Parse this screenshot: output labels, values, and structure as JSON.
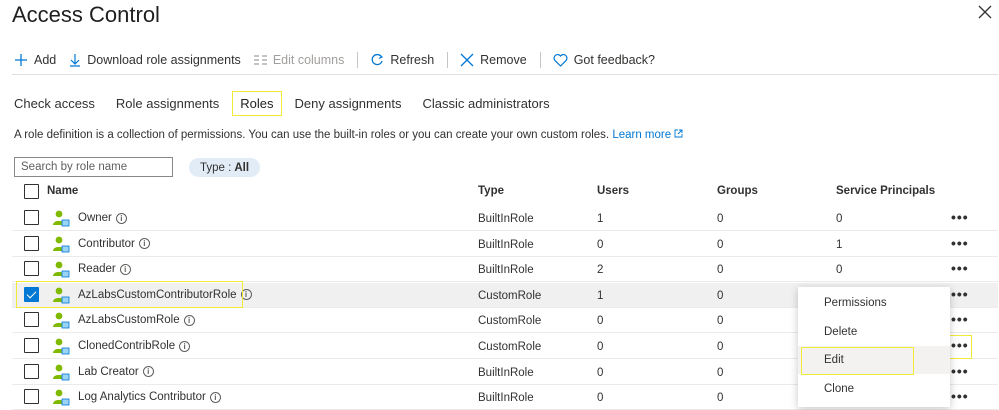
{
  "header": {
    "title": "Access Control"
  },
  "toolbar": {
    "add": "Add",
    "download": "Download role assignments",
    "edit_columns": "Edit columns",
    "refresh": "Refresh",
    "remove": "Remove",
    "feedback": "Got feedback?"
  },
  "tabs": [
    {
      "label": "Check access"
    },
    {
      "label": "Role assignments"
    },
    {
      "label": "Roles"
    },
    {
      "label": "Deny assignments"
    },
    {
      "label": "Classic administrators"
    }
  ],
  "description": {
    "text": "A role definition is a collection of permissions. You can use the built-in roles or you can create your own custom roles.",
    "link": "Learn more"
  },
  "filter": {
    "search_placeholder": "Search by role name",
    "type_label": "Type :",
    "type_value": "All"
  },
  "columns": {
    "name": "Name",
    "type": "Type",
    "users": "Users",
    "groups": "Groups",
    "service_principals": "Service Principals"
  },
  "rows": [
    {
      "name": "Owner",
      "type": "BuiltInRole",
      "users": "1",
      "groups": "0",
      "sp": "0",
      "checked": false
    },
    {
      "name": "Contributor",
      "type": "BuiltInRole",
      "users": "0",
      "groups": "0",
      "sp": "1",
      "checked": false
    },
    {
      "name": "Reader",
      "type": "BuiltInRole",
      "users": "2",
      "groups": "0",
      "sp": "0",
      "checked": false
    },
    {
      "name": "AzLabsCustomContributorRole",
      "type": "CustomRole",
      "users": "1",
      "groups": "0",
      "sp": "",
      "checked": true
    },
    {
      "name": "AzLabsCustomRole",
      "type": "CustomRole",
      "users": "0",
      "groups": "0",
      "sp": "",
      "checked": false
    },
    {
      "name": "ClonedContribRole",
      "type": "CustomRole",
      "users": "0",
      "groups": "0",
      "sp": "",
      "checked": false
    },
    {
      "name": "Lab Creator",
      "type": "BuiltInRole",
      "users": "0",
      "groups": "0",
      "sp": "",
      "checked": false
    },
    {
      "name": "Log Analytics Contributor",
      "type": "BuiltInRole",
      "users": "0",
      "groups": "0",
      "sp": "",
      "checked": false
    }
  ],
  "context_menu": {
    "items": [
      "Permissions",
      "Delete",
      "Edit",
      "Clone"
    ]
  },
  "colors": {
    "accent": "#0078d4",
    "highlight": "#f2ea38",
    "icon_green": "#7fba00"
  }
}
